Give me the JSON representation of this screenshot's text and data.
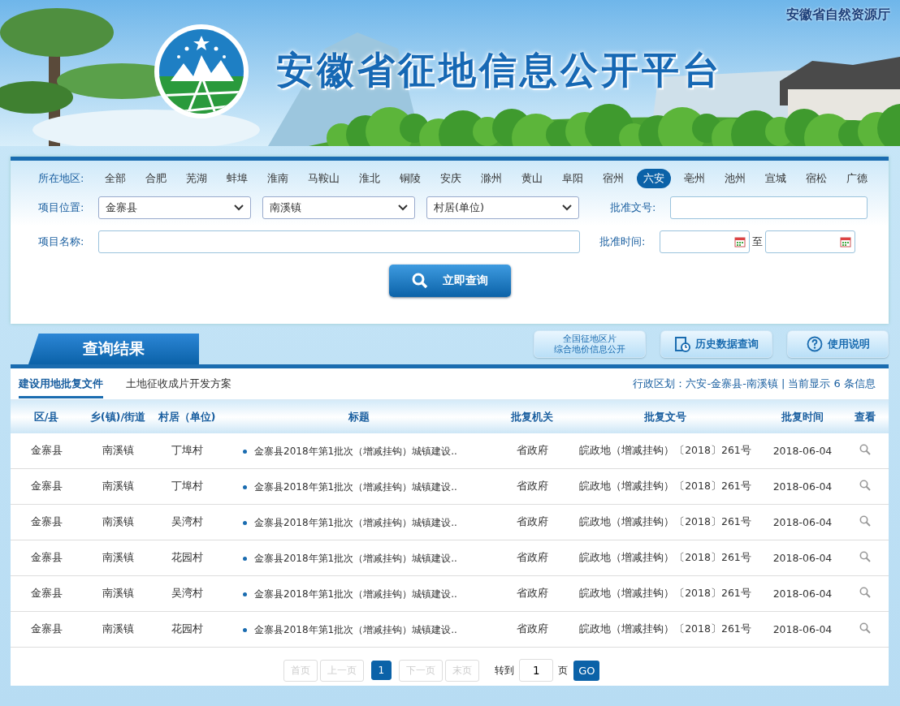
{
  "header": {
    "title": "安徽省征地信息公开平台",
    "agency": "安徽省自然资源厅"
  },
  "search": {
    "region_label": "所在地区:",
    "regions": [
      {
        "label": "全部",
        "selected": false
      },
      {
        "label": "合肥",
        "selected": false
      },
      {
        "label": "芜湖",
        "selected": false
      },
      {
        "label": "蚌埠",
        "selected": false
      },
      {
        "label": "淮南",
        "selected": false
      },
      {
        "label": "马鞍山",
        "selected": false
      },
      {
        "label": "淮北",
        "selected": false
      },
      {
        "label": "铜陵",
        "selected": false
      },
      {
        "label": "安庆",
        "selected": false
      },
      {
        "label": "滁州",
        "selected": false
      },
      {
        "label": "黄山",
        "selected": false
      },
      {
        "label": "阜阳",
        "selected": false
      },
      {
        "label": "宿州",
        "selected": false
      },
      {
        "label": "六安",
        "selected": true
      },
      {
        "label": "亳州",
        "selected": false
      },
      {
        "label": "池州",
        "selected": false
      },
      {
        "label": "宣城",
        "selected": false
      },
      {
        "label": "宿松",
        "selected": false
      },
      {
        "label": "广德",
        "selected": false
      }
    ],
    "location_label": "项目位置:",
    "selects": [
      "金寨县",
      "南溪镇",
      "村居(单位)"
    ],
    "doc_no_label": "批准文号:",
    "name_label": "项目名称:",
    "date_label": "批准时间:",
    "date_sep": "至",
    "submit": "立即查询"
  },
  "results": {
    "title": "查询结果",
    "links": [
      {
        "lines": [
          "全国征地区片",
          "综合地价信息公开"
        ],
        "kind": "text"
      },
      {
        "label": "历史数据查询",
        "kind": "history"
      },
      {
        "label": "使用说明",
        "kind": "help"
      }
    ],
    "tabs": [
      {
        "label": "建设用地批复文件",
        "selected": true
      },
      {
        "label": "土地征收成片开发方案",
        "selected": false
      }
    ],
    "summary": "行政区划：六安-金寨县-南溪镇 | 当前显示 6 条信息",
    "columns": [
      "区/县",
      "乡(镇)/街道",
      "村居（单位)",
      "标题",
      "批复机关",
      "批复文号",
      "批复时间",
      "查看"
    ],
    "rows": [
      {
        "county": "金寨县",
        "town": "南溪镇",
        "village": "丁埠村",
        "title": "金寨县2018年第1批次（增减挂钩）城镇建设..",
        "authority": "省政府",
        "doc_no": "皖政地（增减挂钩）〔2018〕261号",
        "date": "2018-06-04"
      },
      {
        "county": "金寨县",
        "town": "南溪镇",
        "village": "丁埠村",
        "title": "金寨县2018年第1批次（增减挂钩）城镇建设..",
        "authority": "省政府",
        "doc_no": "皖政地（增减挂钩）〔2018〕261号",
        "date": "2018-06-04"
      },
      {
        "county": "金寨县",
        "town": "南溪镇",
        "village": "吴湾村",
        "title": "金寨县2018年第1批次（增减挂钩）城镇建设..",
        "authority": "省政府",
        "doc_no": "皖政地（增减挂钩）〔2018〕261号",
        "date": "2018-06-04"
      },
      {
        "county": "金寨县",
        "town": "南溪镇",
        "village": "花园村",
        "title": "金寨县2018年第1批次（增减挂钩）城镇建设..",
        "authority": "省政府",
        "doc_no": "皖政地（增减挂钩）〔2018〕261号",
        "date": "2018-06-04"
      },
      {
        "county": "金寨县",
        "town": "南溪镇",
        "village": "吴湾村",
        "title": "金寨县2018年第1批次（增减挂钩）城镇建设..",
        "authority": "省政府",
        "doc_no": "皖政地（增减挂钩）〔2018〕261号",
        "date": "2018-06-04"
      },
      {
        "county": "金寨县",
        "town": "南溪镇",
        "village": "花园村",
        "title": "金寨县2018年第1批次（增减挂钩）城镇建设..",
        "authority": "省政府",
        "doc_no": "皖政地（增减挂钩）〔2018〕261号",
        "date": "2018-06-04"
      }
    ],
    "pager": {
      "items": [
        {
          "label": "首页",
          "kind": "nav",
          "disabled": true
        },
        {
          "label": "上一页",
          "kind": "nav",
          "disabled": true
        },
        {
          "label": "1",
          "kind": "page",
          "selected": true
        },
        {
          "label": "下一页",
          "kind": "nav",
          "disabled": true
        },
        {
          "label": "末页",
          "kind": "nav",
          "disabled": true
        }
      ],
      "goto_label": "转到",
      "page_value": "1",
      "page_unit": "页",
      "go": "GO"
    }
  }
}
